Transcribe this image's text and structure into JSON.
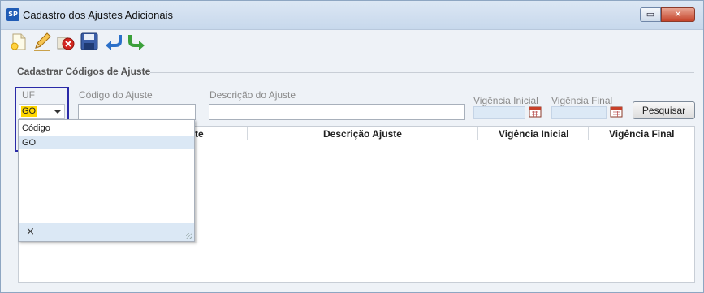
{
  "window": {
    "title": "Cadastro dos Ajustes Adicionais",
    "app_icon": "SP",
    "controls": {
      "minimize": "▭",
      "close": "✕"
    }
  },
  "toolbar": {
    "buttons": [
      "new-icon",
      "edit-icon",
      "delete-icon",
      "save-icon",
      "undo-icon",
      "exit-icon"
    ]
  },
  "form": {
    "section_title": "Cadastrar Códigos de Ajuste",
    "uf_label": "UF",
    "uf_value": "GO",
    "codigo_label": "Código do Ajuste",
    "descricao_label": "Descrição do Ajuste",
    "vigencia_inicial_label": "Vigência Inicial",
    "vigencia_final_label": "Vigência Final",
    "pesquisar_label": "Pesquisar"
  },
  "grid": {
    "columns": [
      "te",
      "Descrição Ajuste",
      "Vigência Inicial",
      "Vigência Final"
    ]
  },
  "dropdown": {
    "header": "Código",
    "rows": [
      "GO"
    ],
    "clear_symbol": "×"
  },
  "colors": {
    "highlight": "#ffd700",
    "focus_border": "#2a2aa8",
    "selected_row": "#dbe8f5"
  }
}
